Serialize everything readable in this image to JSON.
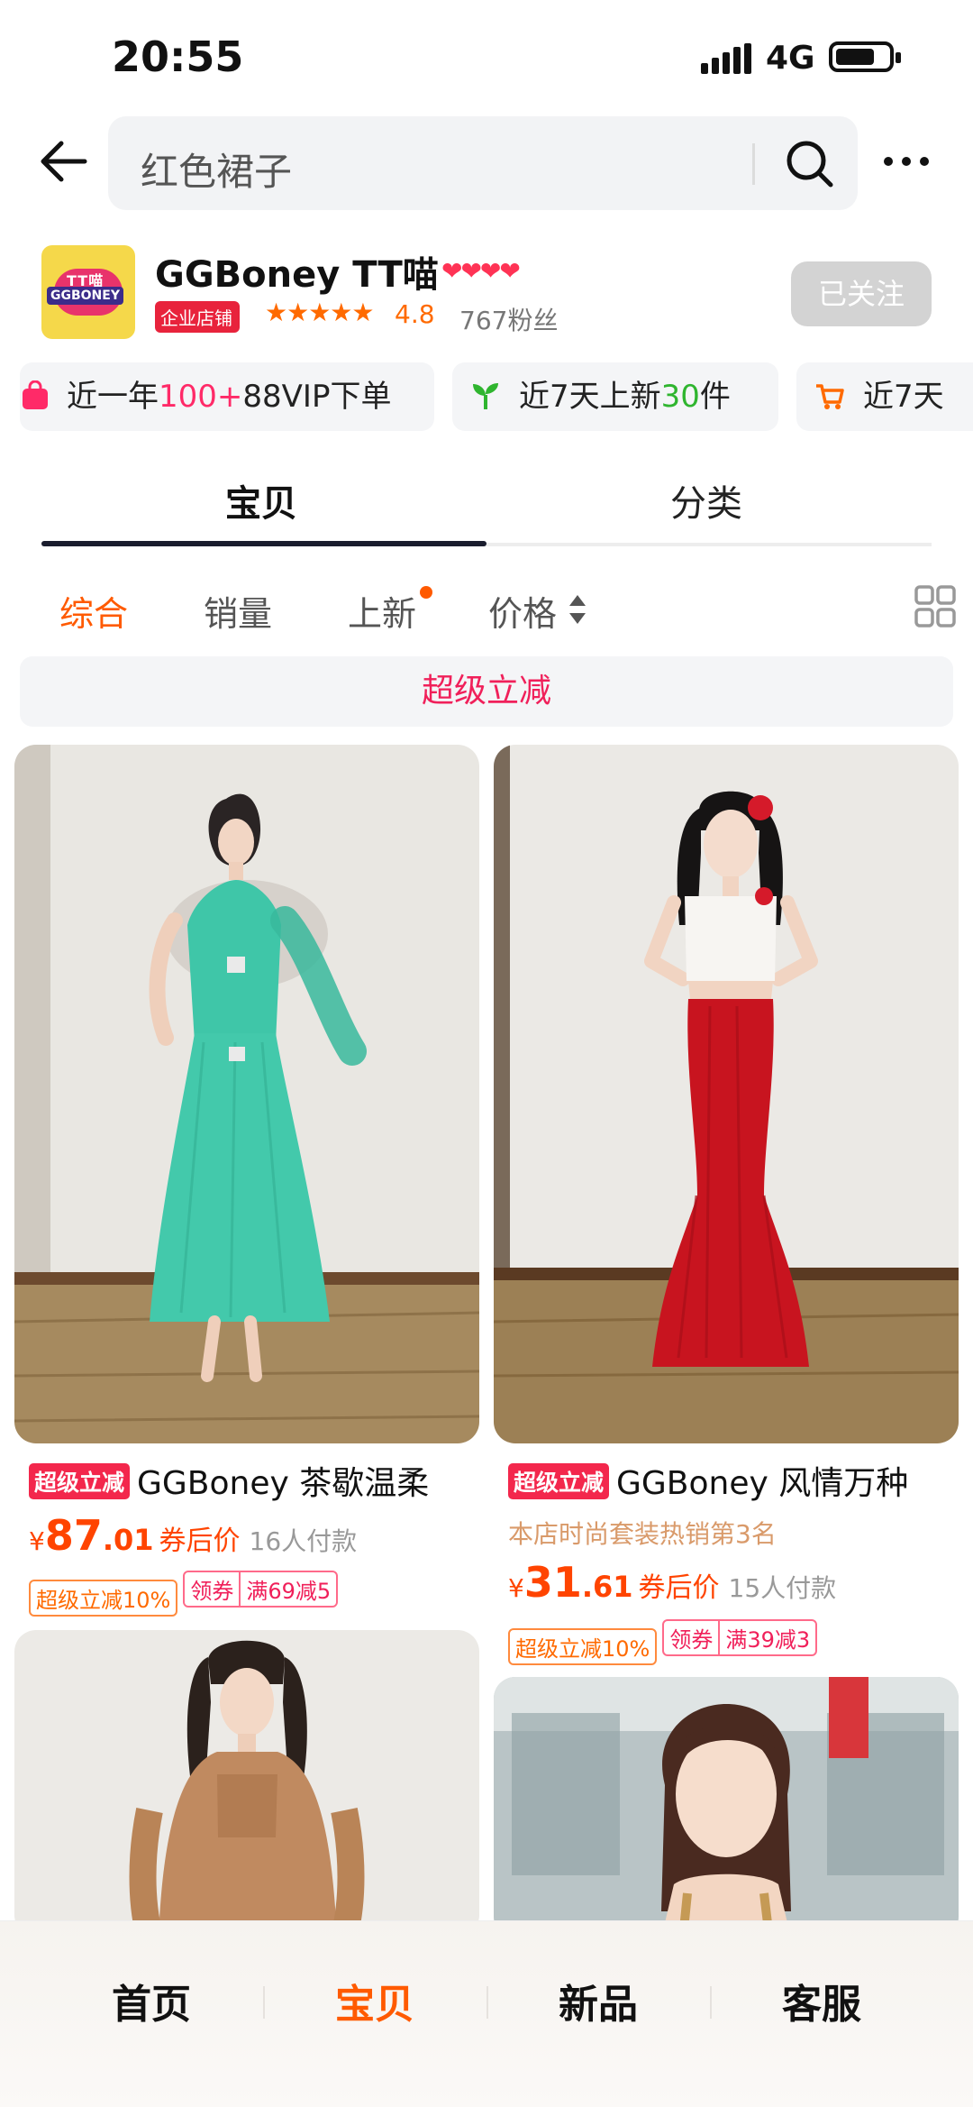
{
  "status_bar": {
    "time": "20:55",
    "network": "4G"
  },
  "search": {
    "query": "红色裙子"
  },
  "shop": {
    "logo_line1": "TT喵",
    "logo_line2": "GGBONEY",
    "name": "GGBoney TT喵",
    "hearts": "❤❤❤❤",
    "badge": "企业店铺",
    "stars": "★★★★★",
    "rating": "4.8",
    "fans": "767粉丝",
    "follow_label": "已关注"
  },
  "info_chips": [
    {
      "pre": "近一年",
      "highlight": "100+",
      "post": "88VIP下单"
    },
    {
      "pre": "近7天上新",
      "highlight": "30",
      "post": "件"
    },
    {
      "pre": "近7天",
      "highlight": "",
      "post": ""
    }
  ],
  "tabs": [
    {
      "label": "宝贝",
      "active": true
    },
    {
      "label": "分类",
      "active": false
    }
  ],
  "sort_options": [
    {
      "label": "综合",
      "active": true
    },
    {
      "label": "销量",
      "active": false
    },
    {
      "label": "上新",
      "active": false
    },
    {
      "label": "价格",
      "active": false
    }
  ],
  "promo_bar": "超级立减",
  "products": [
    {
      "tag": "超级立减",
      "title": "GGBoney 茶歇温柔",
      "subtitle": "",
      "price_currency": "¥",
      "price_int": "87",
      "price_dec": ".01",
      "price_label": "券后价",
      "sold": "16人付款",
      "discount": "超级立减10%",
      "coupon_label": "领券",
      "coupon_value": "满69减5"
    },
    {
      "tag": "超级立减",
      "title": "GGBoney 风情万种",
      "subtitle": "本店时尚套装热销第3名",
      "price_currency": "¥",
      "price_int": "31",
      "price_dec": ".61",
      "price_label": "券后价",
      "sold": "15人付款",
      "discount": "超级立减10%",
      "coupon_label": "领券",
      "coupon_value": "满39减3"
    }
  ],
  "bottom_nav": [
    {
      "label": "首页",
      "active": false
    },
    {
      "label": "宝贝",
      "active": true
    },
    {
      "label": "新品",
      "active": false
    },
    {
      "label": "客服",
      "active": false
    }
  ],
  "colors": {
    "accent": "#ff5a00",
    "promo_pink": "#f0205a",
    "green": "#2fb52f"
  }
}
